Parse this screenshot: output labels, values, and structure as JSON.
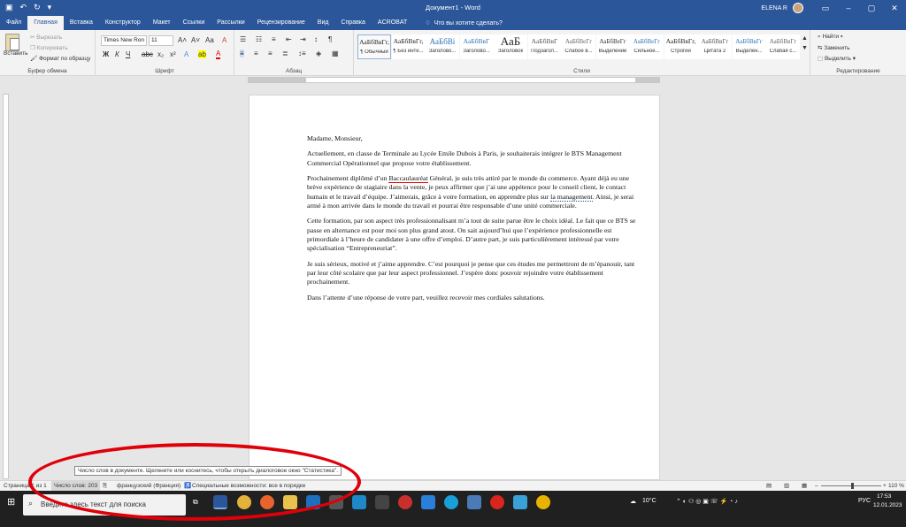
{
  "window": {
    "title": "Документ1 - Word",
    "user": "ELENA R"
  },
  "tabs": [
    "Файл",
    "Главная",
    "Вставка",
    "Конструктор",
    "Макет",
    "Ссылки",
    "Рассылки",
    "Рецензирование",
    "Вид",
    "Справка",
    "ACROBAT"
  ],
  "active_tab": "Главная",
  "tell_me": "Что вы хотите сделать?",
  "clipboard": {
    "paste": "Вставить",
    "cut": "Вырезать",
    "copy": "Копировать",
    "format_painter": "Формат по образцу",
    "label": "Буфер обмена"
  },
  "font": {
    "name": "Times New Ron",
    "size": "11",
    "label": "Шрифт"
  },
  "paragraph": {
    "label": "Абзац"
  },
  "styles": {
    "label": "Стили",
    "items": [
      {
        "preview": "АаБбВвГг,",
        "name": "¶ Обычный"
      },
      {
        "preview": "АаБбВвГг,",
        "name": "¶ Без инте..."
      },
      {
        "preview": "АаБбВі",
        "name": "Заголово..."
      },
      {
        "preview": "АаБбВвГ",
        "name": "Заголово..."
      },
      {
        "preview": "АаБ",
        "name": "Заголовок"
      },
      {
        "preview": "АаБбВвГ",
        "name": "Подзагол..."
      },
      {
        "preview": "АаБбВеГг",
        "name": "Слабое в..."
      },
      {
        "preview": "АаБбВеГг",
        "name": "Выделение"
      },
      {
        "preview": "АаБбВеГг",
        "name": "Сильное..."
      },
      {
        "preview": "АаБбВвГг,",
        "name": "Строгий"
      },
      {
        "preview": "АаБбВвГг",
        "name": "Цитата 2"
      },
      {
        "preview": "АаБбВвГг",
        "name": "Выделен..."
      },
      {
        "preview": "АаБбВвГг",
        "name": "Слабая с..."
      }
    ]
  },
  "editing": {
    "find": "Найти",
    "replace": "Заменить",
    "select": "Выделить",
    "label": "Редактирование"
  },
  "document": {
    "greeting": "Madame, Monsieur,",
    "p1": "Actuellement, en classe de Terminale au Lycée Emile Dubois à Paris, je souhaiterais intégrer le BTS Management Commercial Opérationnel que propose votre établissement.",
    "p2_a": "Prochainement diplômé d’un ",
    "p2_spell": "Baccaulauréat",
    "p2_b": " Général, je suis très attiré par le monde du commerce. Ayant déjà eu une brève expérience de stagiaire dans la vente, je peux affirmer que j’ai une appétence pour le conseil client, le contact humain et le travail d’équipe. J’aimerais, grâce à votre formation, en apprendre plus sur ",
    "p2_gram": "la management",
    "p2_c": ". Ainsi, je serai armé à mon arrivée dans le monde du travail et pourrai être responsable d’une unité commerciale.",
    "p3": "Cette formation, par son aspect très professionnalisant m’a tout de suite parue être le choix idéal. Le fait que ce BTS se passe en alternance est pour moi son plus grand atout. On sait aujourd’hui que l’expérience professionnelle est primordiale à l’heure de candidater à une offre d’emploi. D’autre part, je suis particulièrement intéressé par votre spécialisation “Entrepreneuriat”.",
    "p4": "Je suis sérieux, motivé et j’aime apprendre. C’est pourquoi je pense que ces études me permettront de m’épanouir, tant par leur côté scolaire que par leur aspect professionnel. J’espère donc pouvoir rejoindre votre établissement prochainement.",
    "p5": "Dans l’attente d’une réponse de votre part, veuillez recevoir mes cordiales salutations."
  },
  "tooltip": "Число слов в документе. Щелкните или коснитесь, чтобы открыть диалоговое окно \"Статистика\".",
  "status": {
    "page": "Страница 1 из 1",
    "words": "Число слов: 203",
    "language": "французский (Франция)",
    "accessibility": "Специальные возможности: все в порядке",
    "zoom": "110 %",
    "zoom_level_pct": 110
  },
  "taskbar": {
    "search_placeholder": "Введите здесь текст для поиска",
    "weather": "10°C",
    "lang": "РУС",
    "time": "17:53",
    "date": "12.01.2023"
  },
  "colors": {
    "accent": "#2b579a",
    "highlight_ellipse": "#e0000a"
  }
}
